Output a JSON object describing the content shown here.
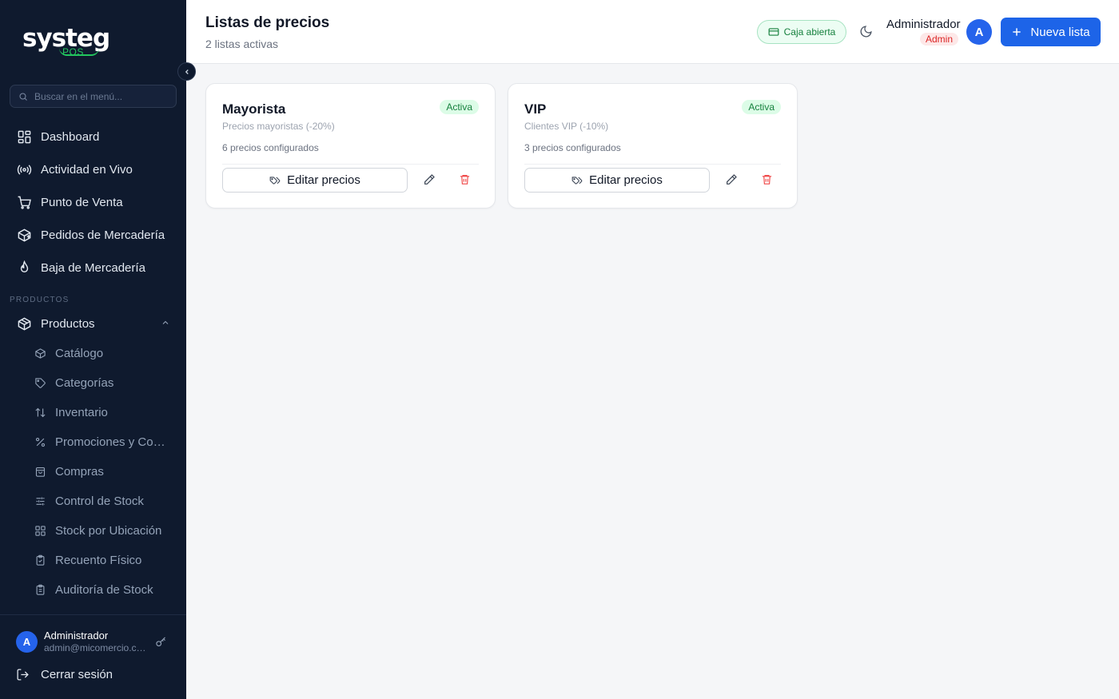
{
  "brand": {
    "name": "systeg",
    "sub": "POS"
  },
  "sidebar": {
    "search_placeholder": "Buscar en el menú...",
    "items": [
      {
        "label": "Dashboard",
        "icon": "dashboard-icon"
      },
      {
        "label": "Actividad en Vivo",
        "icon": "broadcast-icon"
      },
      {
        "label": "Punto de Venta",
        "icon": "cart-icon"
      },
      {
        "label": "Pedidos de Mercadería",
        "icon": "package-icon"
      },
      {
        "label": "Baja de Mercadería",
        "icon": "flame-icon"
      }
    ],
    "section_label": "PRODUCTOS",
    "group": {
      "label": "Productos",
      "icon": "box-icon"
    },
    "sub_items": [
      {
        "label": "Catálogo",
        "icon": "box-icon"
      },
      {
        "label": "Categorías",
        "icon": "tag-icon"
      },
      {
        "label": "Inventario",
        "icon": "sort-arrows-icon"
      },
      {
        "label": "Promociones y Combos",
        "icon": "percent-icon"
      },
      {
        "label": "Compras",
        "icon": "shopping-bag-icon"
      },
      {
        "label": "Control de Stock",
        "icon": "sliders-icon"
      },
      {
        "label": "Stock por Ubicación",
        "icon": "grid-icon"
      },
      {
        "label": "Recuento Físico",
        "icon": "clipboard-check-icon"
      },
      {
        "label": "Auditoría de Stock",
        "icon": "clipboard-list-icon"
      }
    ],
    "user": {
      "initial": "A",
      "name": "Administrador",
      "email": "admin@micomercio.com"
    },
    "logout_label": "Cerrar sesión"
  },
  "header": {
    "title": "Listas de precios",
    "subtitle": "2 listas activas",
    "cash_status": "Caja abierta",
    "user_name": "Administrador",
    "user_role": "Admin",
    "avatar_initial": "A",
    "new_button": "Nueva lista"
  },
  "lists": [
    {
      "name": "Mayorista",
      "description": "Precios mayoristas (-20%)",
      "status": "Activa",
      "count": "6 precios configurados",
      "edit_label": "Editar precios"
    },
    {
      "name": "VIP",
      "description": "Clientes VIP (-10%)",
      "status": "Activa",
      "count": "3 precios configurados",
      "edit_label": "Editar precios"
    }
  ],
  "colors": {
    "sidebar_bg": "#0f1a2e",
    "primary": "#1d64e8",
    "success": "#15803d",
    "danger": "#dc2626"
  }
}
